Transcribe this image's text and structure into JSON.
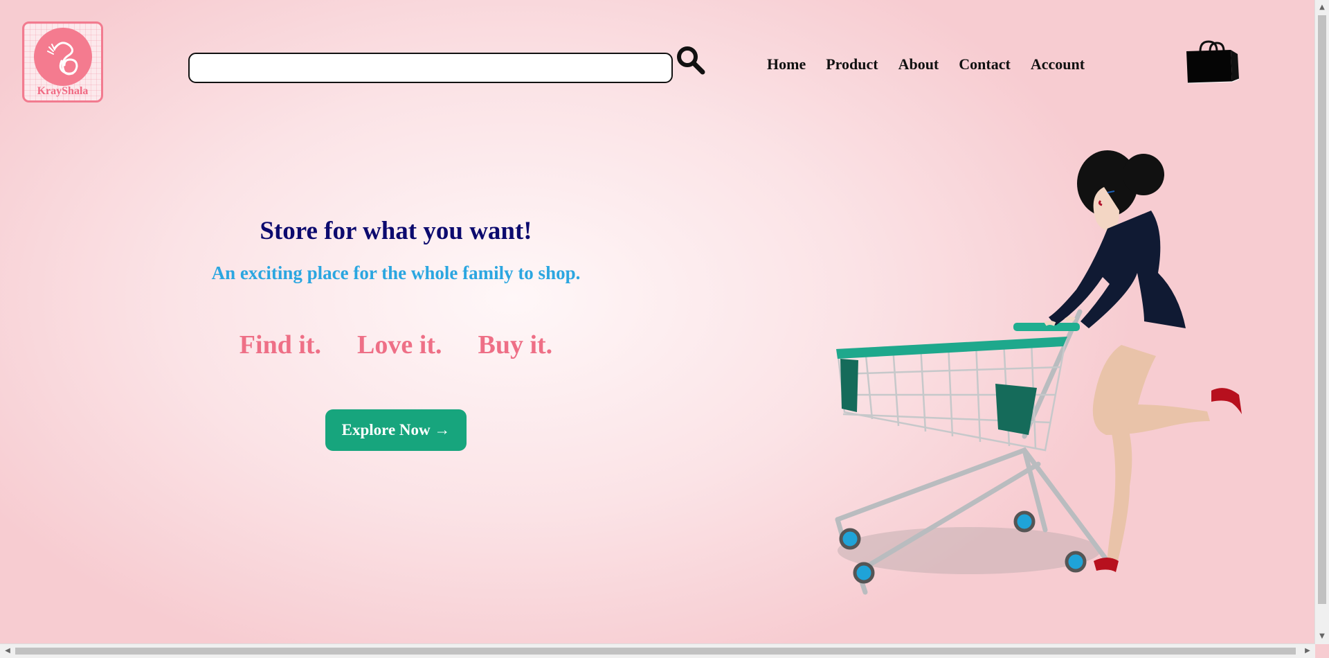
{
  "brand": {
    "name": "KrayShala"
  },
  "search": {
    "value": "",
    "placeholder": ""
  },
  "nav": {
    "home": "Home",
    "product": "Product",
    "about": "About",
    "contact": "Contact",
    "account": "Account"
  },
  "hero": {
    "title": "Store for what you want!",
    "subtitle": "An exciting place for the whole family to shop.",
    "tagline": [
      "Find it.",
      "Love it.",
      "Buy it."
    ],
    "cta": "Explore Now →"
  },
  "icons": {
    "search": "magnifier-icon",
    "cart": "shopping-bag-icon",
    "hero_image": "woman-pushing-shopping-cart"
  },
  "colors": {
    "title": "#0c0a6e",
    "subtitle": "#2ba6e0",
    "tagline": "#ee6f86",
    "cta_bg": "#17a57d",
    "brand": "#f47b8f"
  }
}
